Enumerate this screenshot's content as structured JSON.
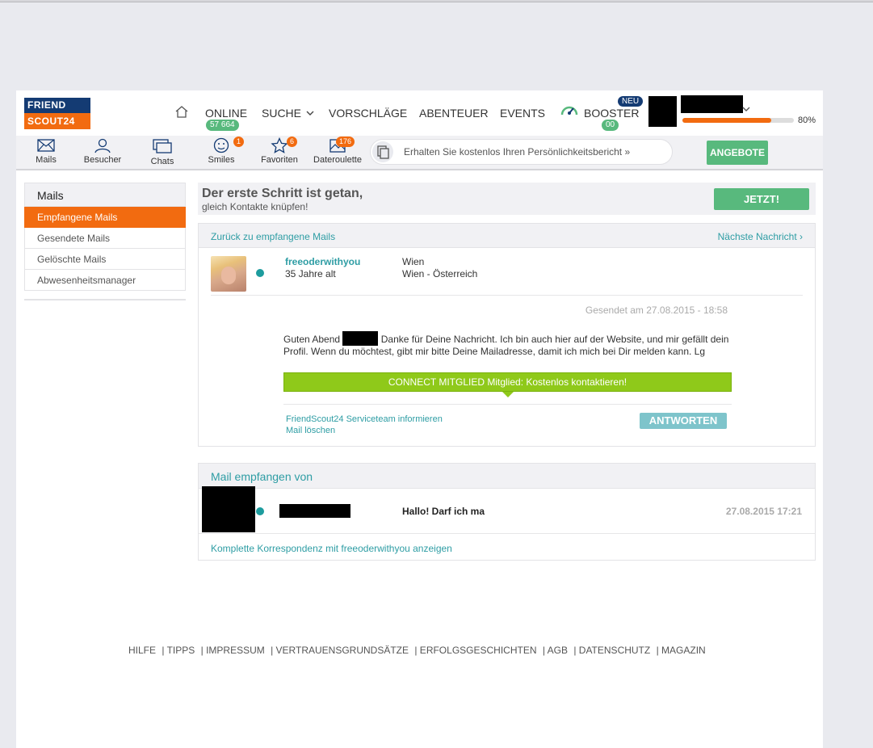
{
  "header": {
    "logo_line1": "FRIEND",
    "logo_line2": "SCOUT24",
    "nav": {
      "online_label": "ONLINE",
      "online_count": "57 664",
      "suche_label": "SUCHE",
      "vorschlaege_label": "VORSCHLÄGE",
      "abenteuer_label": "ABENTEUER",
      "events_label": "EVENTS",
      "booster_label": "BOOSTER",
      "booster_badge": "00",
      "neu_badge": "NEU"
    },
    "profile_progress": 0.8,
    "profile_progress_label": "80%"
  },
  "iconbar": {
    "items": [
      {
        "label": "Mails",
        "icon": "mail-icon"
      },
      {
        "label": "Besucher",
        "icon": "user-icon"
      },
      {
        "label": "Chats",
        "icon": "chat-icon"
      },
      {
        "label": "Smiles",
        "icon": "smiley-icon",
        "badge": "1"
      },
      {
        "label": "Favoriten",
        "icon": "star-icon",
        "badge": "6"
      },
      {
        "label": "Dateroulette",
        "icon": "photo-icon",
        "badge": "176"
      }
    ],
    "personality_text": "Erhalten Sie kostenlos Ihren Persönlichkeitsbericht »",
    "angebote_label": "ANGEBOTE"
  },
  "sidebar": {
    "title": "Mails",
    "items": [
      {
        "label": "Empfangene Mails",
        "active": true
      },
      {
        "label": "Gesendete Mails"
      },
      {
        "label": "Gelöschte Mails"
      },
      {
        "label": "Abwesenheitsmanager"
      }
    ]
  },
  "banner": {
    "title": "Der erste Schritt ist getan,",
    "subtitle": "gleich Kontakte knüpfen!",
    "button_label": "JETZT!"
  },
  "mail": {
    "back_link": "Zurück zu empfangene Mails",
    "next_link": "Nächste Nachricht ›",
    "sender_name": "freeoderwithyou",
    "sender_age": "35 Jahre alt",
    "sender_city": "Wien",
    "sender_region": "Wien - Österreich",
    "sent_date": "Gesendet am 27.08.2015 - 18:58",
    "body_start": "Guten Abend",
    "body_rest": "Danke für Deine Nachricht. Ich bin auch hier auf der Website, und mir gefällt dein Profil. Wenn du möchtest, gibt mir bitte Deine Mailadresse, damit ich mich bei Dir melden kann. Lg",
    "connect_text": "CONNECT MITGLIED Mitglied: Kostenlos kontaktieren!",
    "link_report": "FriendScout24 Serviceteam informieren",
    "link_delete": "Mail löschen",
    "reply_label": "ANTWORTEN"
  },
  "received_from": {
    "title": "Mail empfangen von",
    "subject": "Hallo! Darf ich ma",
    "date": "27.08.2015 17:21",
    "full_link": "Komplette Korrespondenz mit freeoderwithyou anzeigen"
  },
  "footer": {
    "links": [
      "HILFE",
      "| TIPPS",
      "| IMPRESSUM",
      "| VERTRAUENSGRUNDSÄTZE",
      "| ERFOLGSGESCHICHTEN",
      "| AGB",
      "| DATENSCHUTZ",
      "| MAGAZIN"
    ]
  },
  "colors": {
    "brand_blue": "#143b73",
    "brand_orange": "#f26b10",
    "green_button": "#58b97d",
    "teal_link": "#2e9da4",
    "connect_green": "#8fc91a"
  }
}
